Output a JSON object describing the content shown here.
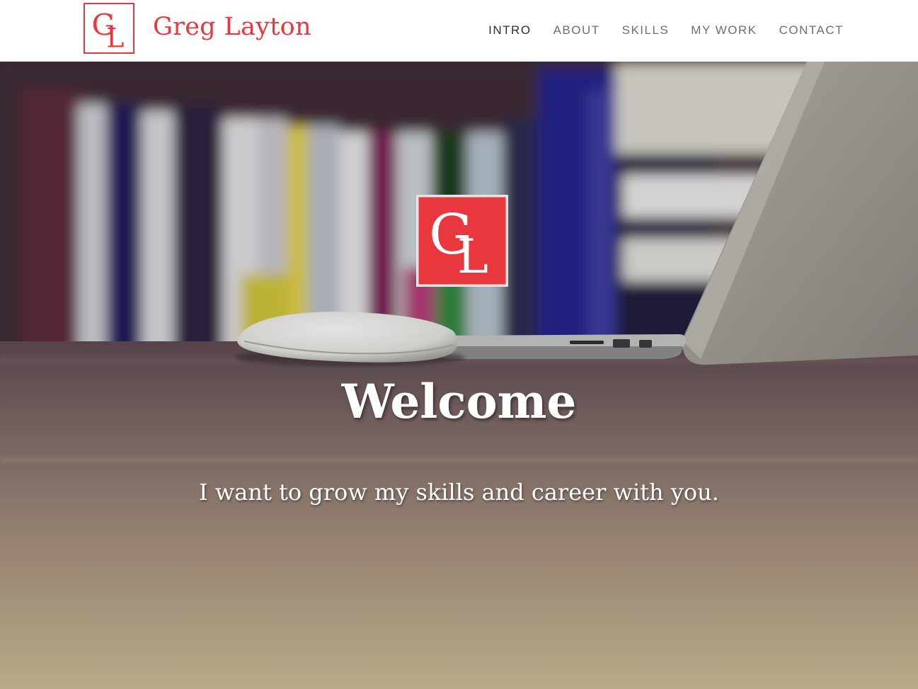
{
  "brand": {
    "logo_initials": "GL",
    "name": "Greg Layton",
    "accent_color": "#e8373d"
  },
  "nav": {
    "items": [
      {
        "label": "INTRO",
        "active": true
      },
      {
        "label": "ABOUT",
        "active": false
      },
      {
        "label": "SKILLS",
        "active": false
      },
      {
        "label": "MY WORK",
        "active": false
      },
      {
        "label": "CONTACT",
        "active": false
      }
    ]
  },
  "hero": {
    "logo_initials": "GL",
    "title": "Welcome",
    "subtitle": "I want to grow my skills and career with you."
  }
}
